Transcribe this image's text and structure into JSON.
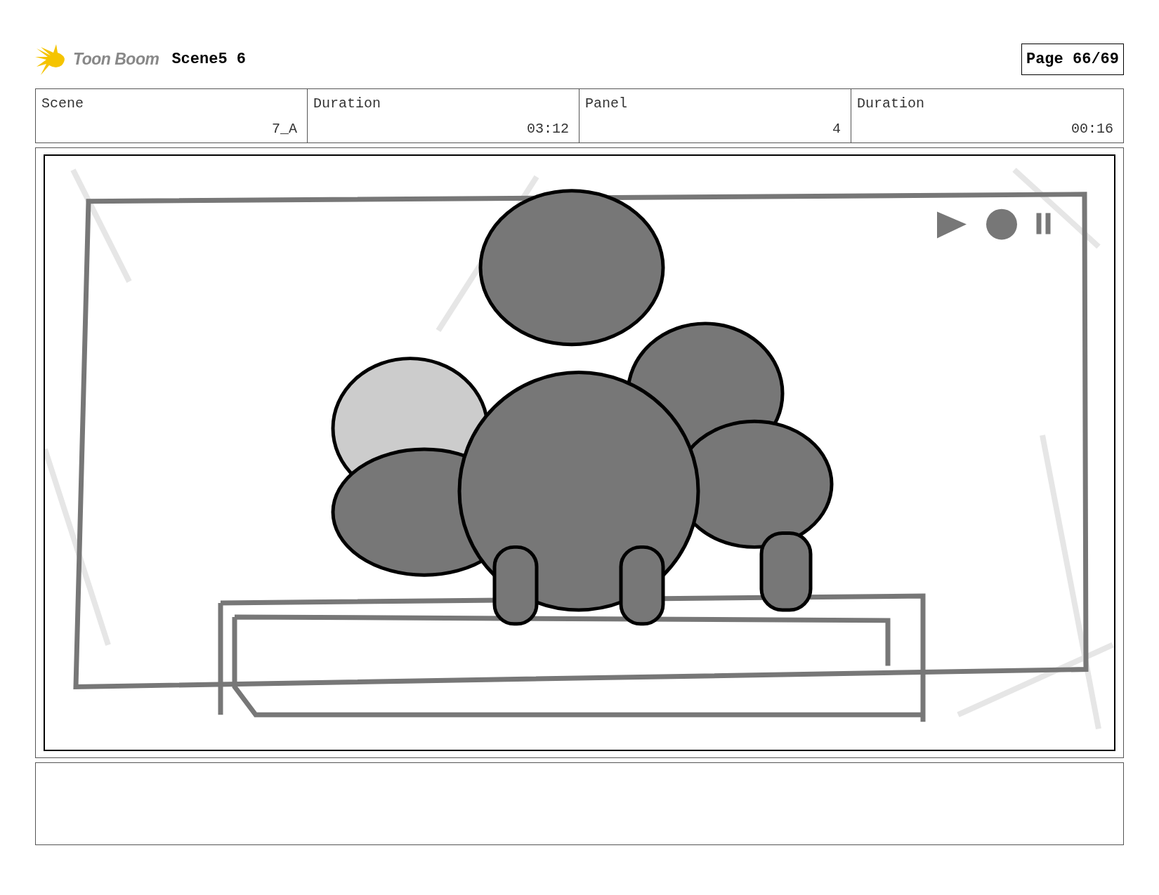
{
  "header": {
    "logo": "Toon Boom",
    "title": "Scene5 6",
    "page": "Page 66/69"
  },
  "info": [
    {
      "label": "Scene",
      "value": "7_A"
    },
    {
      "label": "Duration",
      "value": "03:12"
    },
    {
      "label": "Panel",
      "value": "4"
    },
    {
      "label": "Duration",
      "value": "00:16"
    }
  ]
}
